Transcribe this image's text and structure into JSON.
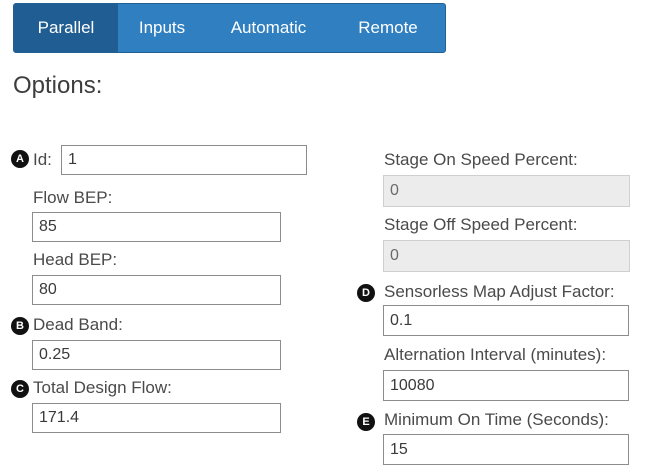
{
  "tabs": [
    {
      "label": "Parallel",
      "active": true
    },
    {
      "label": "Inputs",
      "active": false
    },
    {
      "label": "Automatic",
      "active": false
    },
    {
      "label": "Remote",
      "active": false
    }
  ],
  "title": "Options:",
  "markers": {
    "a": "A",
    "b": "B",
    "c": "C",
    "d": "D",
    "e": "E"
  },
  "left": {
    "id": {
      "label": "Id:",
      "value": "1"
    },
    "flow_bep": {
      "label": "Flow BEP:",
      "value": "85"
    },
    "head_bep": {
      "label": "Head BEP:",
      "value": "80"
    },
    "dead_band": {
      "label": "Dead Band:",
      "value": "0.25"
    },
    "total_design_flow": {
      "label": "Total Design Flow:",
      "value": "171.4"
    }
  },
  "right": {
    "stage_on": {
      "label": "Stage On Speed Percent:",
      "value": "0"
    },
    "stage_off": {
      "label": "Stage Off Speed Percent:",
      "value": "0"
    },
    "sensorless": {
      "label": "Sensorless Map Adjust Factor:",
      "value": "0.1"
    },
    "alternation": {
      "label": "Alternation Interval (minutes):",
      "value": "10080"
    },
    "min_on": {
      "label": "Minimum On Time (Seconds):",
      "value": "15"
    }
  },
  "colors": {
    "tab_bg": "#2f7fc1",
    "tab_active": "#1f5d93",
    "disabled_field": "#ececec"
  }
}
